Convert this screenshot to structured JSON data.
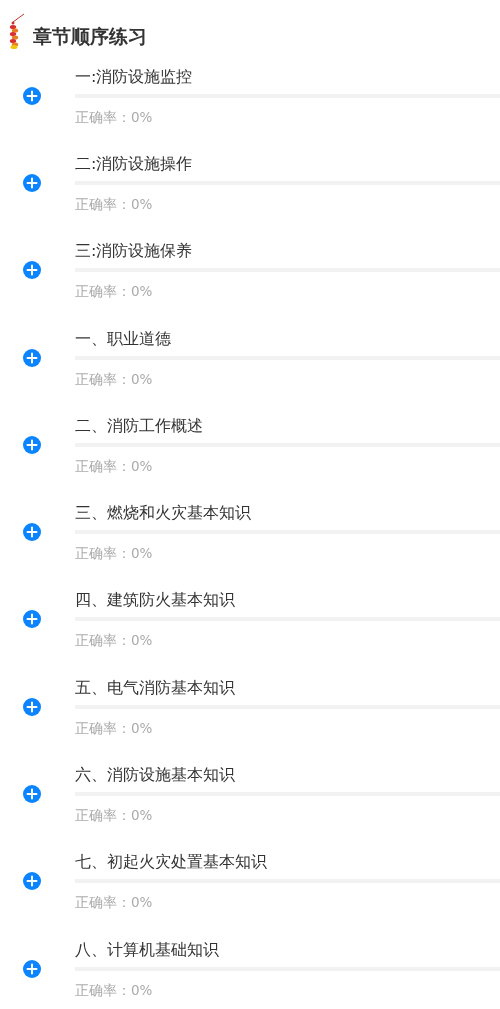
{
  "header": {
    "title": "章节顺序练习"
  },
  "chapters": [
    {
      "title": "一:消防设施监控",
      "level": 0,
      "accuracy": "正确率：0%"
    },
    {
      "title": "二:消防设施操作",
      "level": 0,
      "accuracy": "正确率：0%"
    },
    {
      "title": "三:消防设施保养",
      "level": 0,
      "accuracy": "正确率：0%"
    },
    {
      "title": "一、职业道德",
      "level": 0,
      "accuracy": "正确率：0%"
    },
    {
      "title": "二、消防工作概述",
      "level": 0,
      "accuracy": "正确率：0%"
    },
    {
      "title": "三、燃烧和火灾基本知识",
      "level": 0,
      "accuracy": "正确率：0%"
    },
    {
      "title": "四、建筑防火基本知识",
      "level": 0,
      "accuracy": "正确率：0%"
    },
    {
      "title": "五、电气消防基本知识",
      "level": 0,
      "accuracy": "正确率：0%"
    },
    {
      "title": "六、消防设施基本知识",
      "level": 0,
      "accuracy": "正确率：0%"
    },
    {
      "title": "七、初起火灾处置基本知识",
      "level": 0,
      "accuracy": "正确率：0%"
    },
    {
      "title": "八、计算机基础知识",
      "level": 0,
      "accuracy": "正确率：0%"
    }
  ]
}
